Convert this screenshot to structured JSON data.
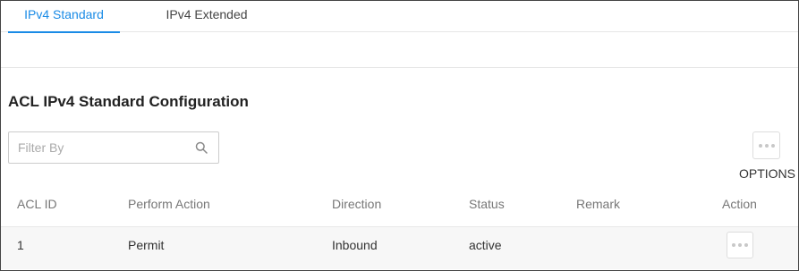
{
  "tabs": [
    {
      "label": "IPv4 Standard",
      "active": true
    },
    {
      "label": "IPv4 Extended",
      "active": false
    }
  ],
  "section": {
    "title": "ACL IPv4 Standard Configuration"
  },
  "filter": {
    "placeholder": "Filter By",
    "value": "",
    "icon": "search-icon"
  },
  "options": {
    "label": "OPTIONS",
    "icon": "more-horizontal-icon"
  },
  "table": {
    "columns": [
      "ACL ID",
      "Perform Action",
      "Direction",
      "Status",
      "Remark",
      "Action"
    ],
    "rows": [
      {
        "acl_id": "1",
        "perform_action": "Permit",
        "direction": "Inbound",
        "status": "active",
        "remark": "",
        "action_icon": "more-horizontal-icon"
      }
    ]
  },
  "colors": {
    "accent": "#1a8be6",
    "border": "#cccccc",
    "row_bg": "#f7f7f7"
  }
}
